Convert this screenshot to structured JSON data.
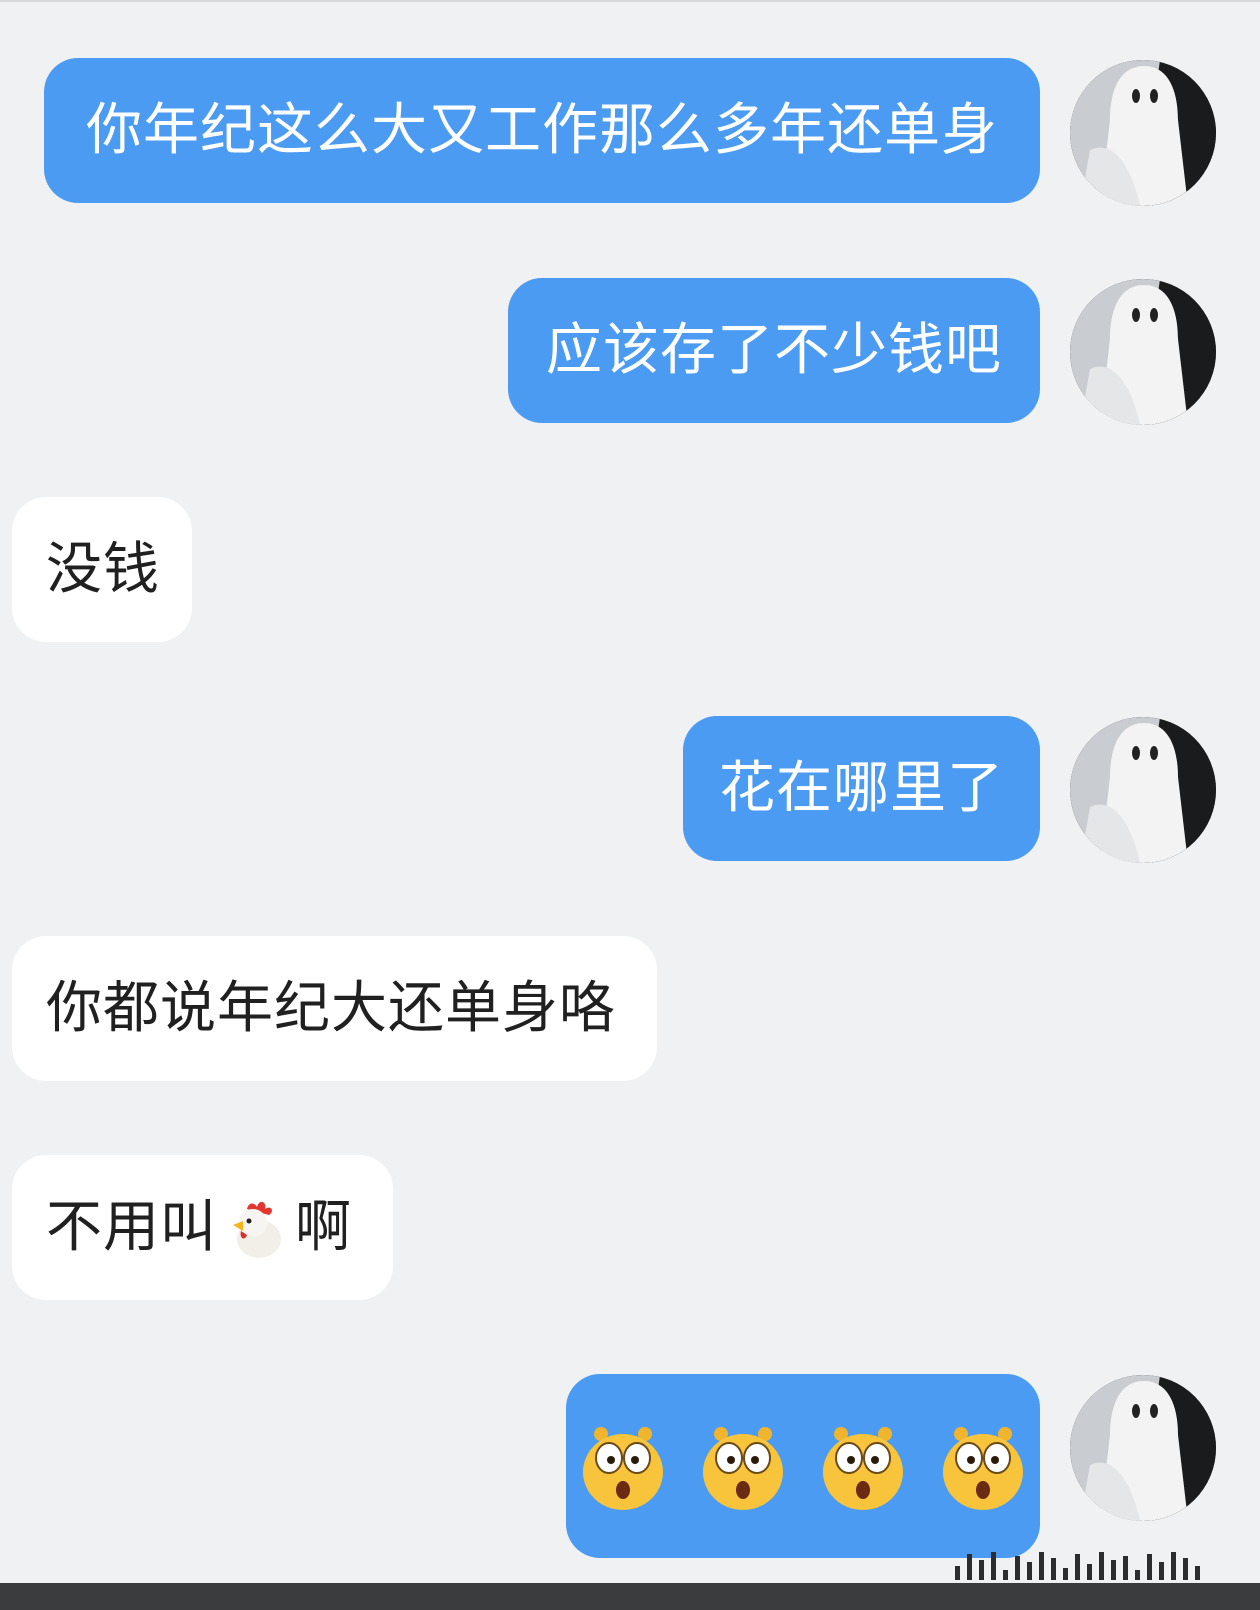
{
  "messages": [
    {
      "side": "out",
      "text": "你年纪这么大又工作那么多年还单身"
    },
    {
      "side": "out",
      "text": "应该存了不少钱吧"
    },
    {
      "side": "in",
      "text": "没钱"
    },
    {
      "side": "out",
      "text": "花在哪里了"
    },
    {
      "side": "in",
      "text": "你都说年纪大还单身咯"
    },
    {
      "side": "in",
      "text_before": "不用叫",
      "emoji": "rooster-emoji",
      "text_after": "啊"
    },
    {
      "side": "out",
      "emojis": [
        "astonished-emoji",
        "astonished-emoji",
        "astonished-emoji",
        "astonished-emoji"
      ]
    }
  ],
  "avatar": "ghost-avatar",
  "colors": {
    "background": "#eff1f2",
    "outgoing_bubble": "#4a9bf1",
    "incoming_bubble": "#ffffff"
  }
}
